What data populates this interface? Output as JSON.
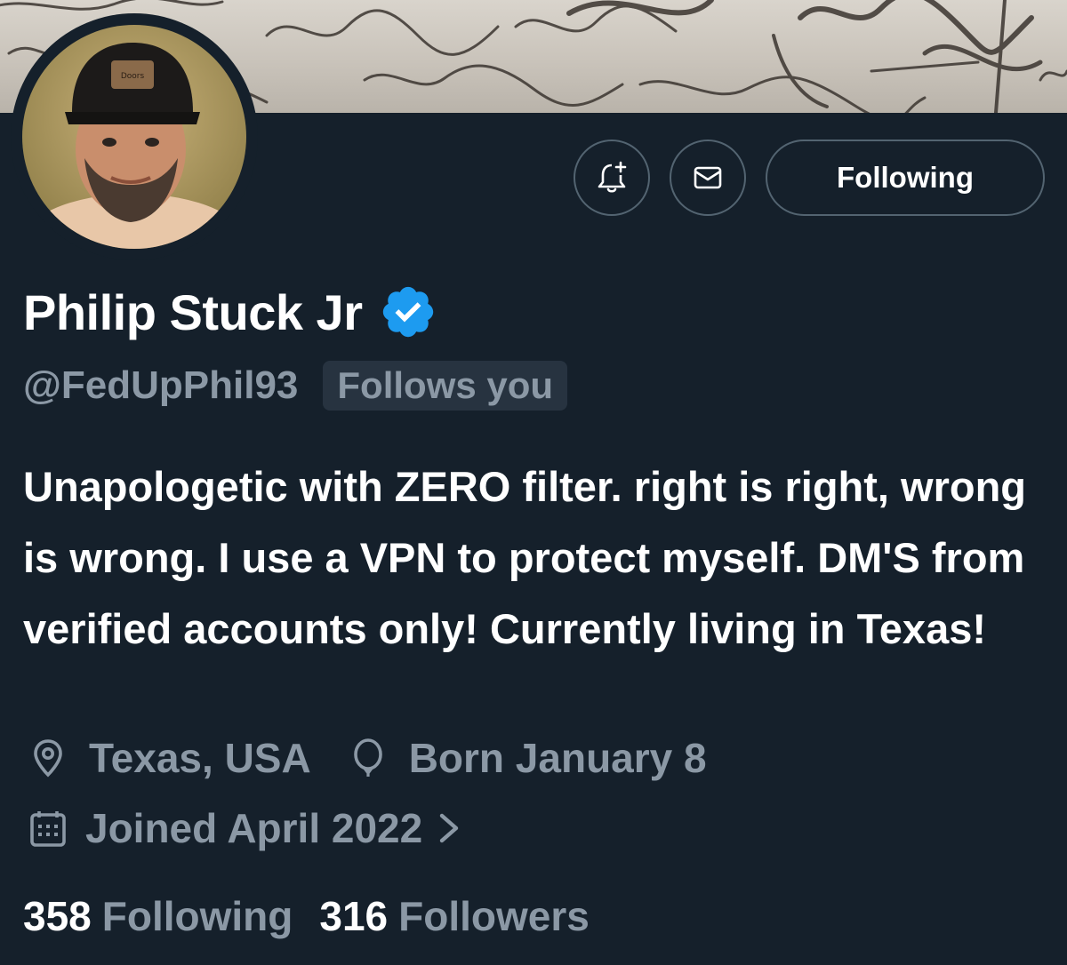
{
  "profile": {
    "display_name": "Philip Stuck Jr",
    "handle": "@FedUpPhil93",
    "follows_you_badge": "Follows you",
    "bio": "Unapologetic with ZERO filter. right is right, wrong is wrong. I use a VPN to protect myself. DM'S from verified accounts only! Currently living in Texas!",
    "location": "Texas, USA",
    "birthday": "Born January 8",
    "joined": "Joined April 2022",
    "following_count": "358",
    "following_label": "Following",
    "followers_count": "316",
    "followers_label": "Followers",
    "verified": true
  },
  "actions": {
    "notify_icon": "bell-plus-icon",
    "message_icon": "envelope-icon",
    "following_button_label": "Following"
  },
  "colors": {
    "background": "#15202b",
    "secondary_text": "#8b98a5",
    "verified_badge": "#1d9bf0",
    "button_border": "#536471"
  }
}
